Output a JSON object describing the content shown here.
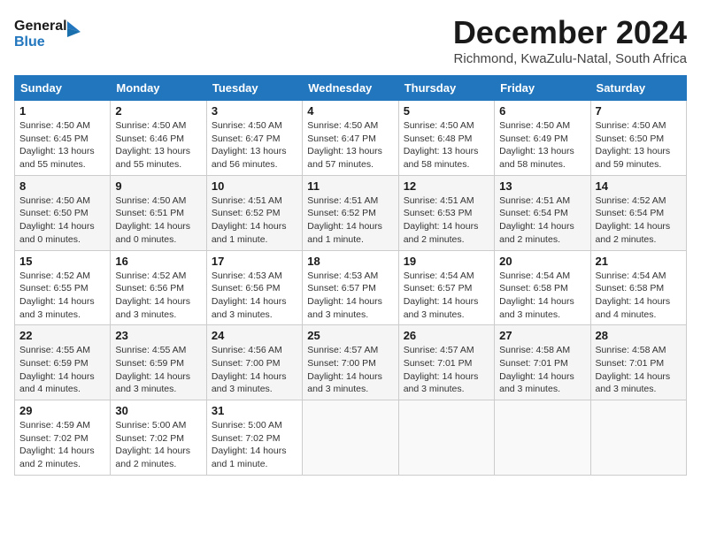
{
  "header": {
    "logo_line1": "General",
    "logo_line2": "Blue",
    "month_title": "December 2024",
    "location": "Richmond, KwaZulu-Natal, South Africa"
  },
  "columns": [
    "Sunday",
    "Monday",
    "Tuesday",
    "Wednesday",
    "Thursday",
    "Friday",
    "Saturday"
  ],
  "weeks": [
    [
      {
        "day": "1",
        "info": "Sunrise: 4:50 AM\nSunset: 6:45 PM\nDaylight: 13 hours\nand 55 minutes."
      },
      {
        "day": "2",
        "info": "Sunrise: 4:50 AM\nSunset: 6:46 PM\nDaylight: 13 hours\nand 55 minutes."
      },
      {
        "day": "3",
        "info": "Sunrise: 4:50 AM\nSunset: 6:47 PM\nDaylight: 13 hours\nand 56 minutes."
      },
      {
        "day": "4",
        "info": "Sunrise: 4:50 AM\nSunset: 6:47 PM\nDaylight: 13 hours\nand 57 minutes."
      },
      {
        "day": "5",
        "info": "Sunrise: 4:50 AM\nSunset: 6:48 PM\nDaylight: 13 hours\nand 58 minutes."
      },
      {
        "day": "6",
        "info": "Sunrise: 4:50 AM\nSunset: 6:49 PM\nDaylight: 13 hours\nand 58 minutes."
      },
      {
        "day": "7",
        "info": "Sunrise: 4:50 AM\nSunset: 6:50 PM\nDaylight: 13 hours\nand 59 minutes."
      }
    ],
    [
      {
        "day": "8",
        "info": "Sunrise: 4:50 AM\nSunset: 6:50 PM\nDaylight: 14 hours\nand 0 minutes."
      },
      {
        "day": "9",
        "info": "Sunrise: 4:50 AM\nSunset: 6:51 PM\nDaylight: 14 hours\nand 0 minutes."
      },
      {
        "day": "10",
        "info": "Sunrise: 4:51 AM\nSunset: 6:52 PM\nDaylight: 14 hours\nand 1 minute."
      },
      {
        "day": "11",
        "info": "Sunrise: 4:51 AM\nSunset: 6:52 PM\nDaylight: 14 hours\nand 1 minute."
      },
      {
        "day": "12",
        "info": "Sunrise: 4:51 AM\nSunset: 6:53 PM\nDaylight: 14 hours\nand 2 minutes."
      },
      {
        "day": "13",
        "info": "Sunrise: 4:51 AM\nSunset: 6:54 PM\nDaylight: 14 hours\nand 2 minutes."
      },
      {
        "day": "14",
        "info": "Sunrise: 4:52 AM\nSunset: 6:54 PM\nDaylight: 14 hours\nand 2 minutes."
      }
    ],
    [
      {
        "day": "15",
        "info": "Sunrise: 4:52 AM\nSunset: 6:55 PM\nDaylight: 14 hours\nand 3 minutes."
      },
      {
        "day": "16",
        "info": "Sunrise: 4:52 AM\nSunset: 6:56 PM\nDaylight: 14 hours\nand 3 minutes."
      },
      {
        "day": "17",
        "info": "Sunrise: 4:53 AM\nSunset: 6:56 PM\nDaylight: 14 hours\nand 3 minutes."
      },
      {
        "day": "18",
        "info": "Sunrise: 4:53 AM\nSunset: 6:57 PM\nDaylight: 14 hours\nand 3 minutes."
      },
      {
        "day": "19",
        "info": "Sunrise: 4:54 AM\nSunset: 6:57 PM\nDaylight: 14 hours\nand 3 minutes."
      },
      {
        "day": "20",
        "info": "Sunrise: 4:54 AM\nSunset: 6:58 PM\nDaylight: 14 hours\nand 3 minutes."
      },
      {
        "day": "21",
        "info": "Sunrise: 4:54 AM\nSunset: 6:58 PM\nDaylight: 14 hours\nand 4 minutes."
      }
    ],
    [
      {
        "day": "22",
        "info": "Sunrise: 4:55 AM\nSunset: 6:59 PM\nDaylight: 14 hours\nand 4 minutes."
      },
      {
        "day": "23",
        "info": "Sunrise: 4:55 AM\nSunset: 6:59 PM\nDaylight: 14 hours\nand 3 minutes."
      },
      {
        "day": "24",
        "info": "Sunrise: 4:56 AM\nSunset: 7:00 PM\nDaylight: 14 hours\nand 3 minutes."
      },
      {
        "day": "25",
        "info": "Sunrise: 4:57 AM\nSunset: 7:00 PM\nDaylight: 14 hours\nand 3 minutes."
      },
      {
        "day": "26",
        "info": "Sunrise: 4:57 AM\nSunset: 7:01 PM\nDaylight: 14 hours\nand 3 minutes."
      },
      {
        "day": "27",
        "info": "Sunrise: 4:58 AM\nSunset: 7:01 PM\nDaylight: 14 hours\nand 3 minutes."
      },
      {
        "day": "28",
        "info": "Sunrise: 4:58 AM\nSunset: 7:01 PM\nDaylight: 14 hours\nand 3 minutes."
      }
    ],
    [
      {
        "day": "29",
        "info": "Sunrise: 4:59 AM\nSunset: 7:02 PM\nDaylight: 14 hours\nand 2 minutes."
      },
      {
        "day": "30",
        "info": "Sunrise: 5:00 AM\nSunset: 7:02 PM\nDaylight: 14 hours\nand 2 minutes."
      },
      {
        "day": "31",
        "info": "Sunrise: 5:00 AM\nSunset: 7:02 PM\nDaylight: 14 hours\nand 1 minute."
      },
      {
        "day": "",
        "info": ""
      },
      {
        "day": "",
        "info": ""
      },
      {
        "day": "",
        "info": ""
      },
      {
        "day": "",
        "info": ""
      }
    ]
  ]
}
